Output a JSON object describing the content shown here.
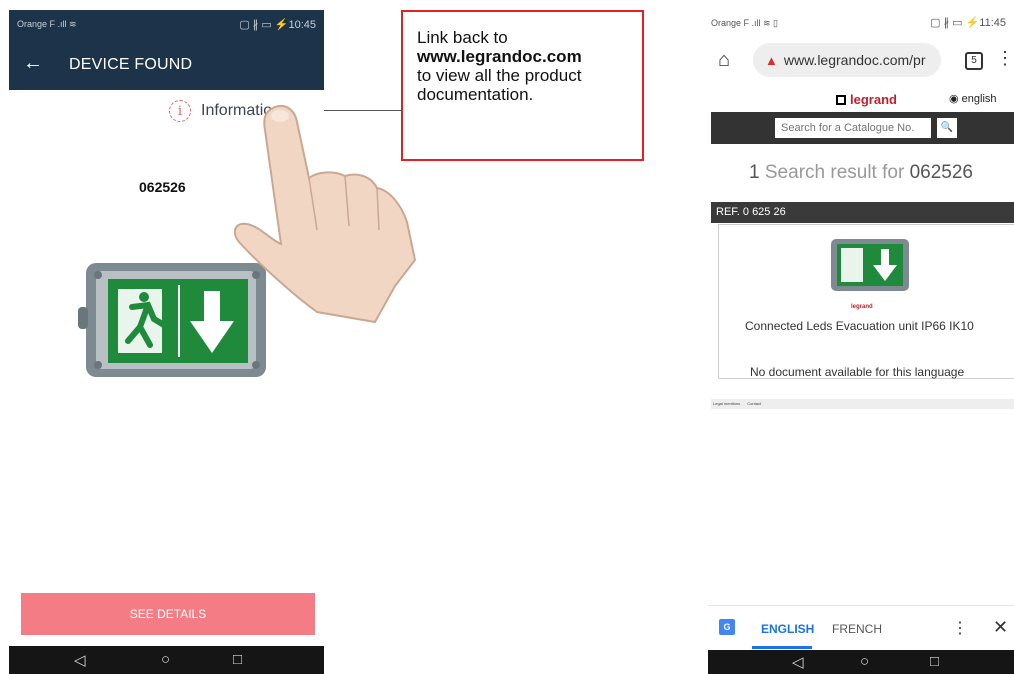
{
  "left_phone": {
    "status_carrier": "Orange F  .ıll ≋",
    "status_right": "▢ ∦ ▭ ⚡10:45",
    "back_icon": "←",
    "title": "DEVICE FOUND",
    "info_icon": "i",
    "info_label": "Informations",
    "reference": "062526",
    "button_label": "SEE DETAILS",
    "nav": {
      "back": "◁",
      "home": "○",
      "recent": "□"
    }
  },
  "callout": {
    "line1": "Link back to",
    "link": "www.legrandoc.com",
    "line3": "to view all the product documentation."
  },
  "right_phone": {
    "status_carrier": "Orange F  .ıll ≋ ▯",
    "status_right": "▢ ∦ ▭ ⚡11:45",
    "home_icon": "⌂",
    "url_warning_icon": "▲",
    "url": "www.legrandoc.com/pr",
    "tabs_count": "5",
    "menu_icon": "⋮",
    "brand": "legrand",
    "language_link": "english",
    "search_placeholder": "Search for a Catalogue No.",
    "search_button_icon": "🔍",
    "results_count": "1",
    "results_text": " Search result for ",
    "results_query": "062526",
    "ref_header": "REF. 0 625 26",
    "mini_brand": "legrand",
    "product_description": "Connected Leds Evacuation unit IP66 IK10",
    "no_document": "No document available for this language",
    "footer_links": [
      "Legal mentions",
      "Contact"
    ],
    "translate": {
      "gt_icon": "G",
      "lang_active": "ENGLISH",
      "lang_other": "FRENCH",
      "menu_icon": "⋮",
      "close_icon": "✕"
    },
    "nav": {
      "back": "◁",
      "home": "○",
      "recent": "□"
    }
  },
  "colors": {
    "header_navy": "#1d3349",
    "button_pink": "#f47c84",
    "callout_red": "#e32124",
    "legrand_red": "#c0202a",
    "translate_blue": "#1a73e8",
    "exit_green": "#1f8a3c"
  }
}
